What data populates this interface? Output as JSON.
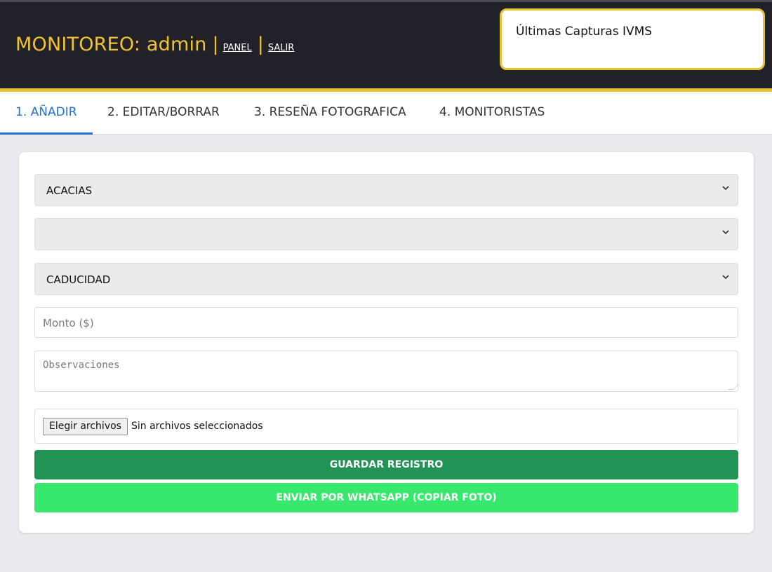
{
  "header": {
    "title": "MONITOREO: admin",
    "separator": "|",
    "links": [
      "PANEL",
      "SALIR"
    ]
  },
  "captures_panel": {
    "title": "Últimas Capturas IVMS"
  },
  "tabs": [
    {
      "label": "1. AÑADIR",
      "active": true
    },
    {
      "label": "2. EDITAR/BORRAR",
      "active": false
    },
    {
      "label": "3. RESEÑA FOTOGRAFICA",
      "active": false
    },
    {
      "label": "4. MONITORISTAS",
      "active": false
    }
  ],
  "form": {
    "location_select": {
      "value": "ACACIAS"
    },
    "second_select": {
      "value": ""
    },
    "type_select": {
      "value": "CADUCIDAD"
    },
    "amount_input": {
      "placeholder": "Monto ($)"
    },
    "notes_textarea": {
      "placeholder": "Observaciones"
    },
    "file_input": {
      "button_label": "Elegir archivos",
      "status": "Sin archivos seleccionados"
    },
    "save_button": {
      "label": "GUARDAR REGISTRO"
    },
    "whatsapp_button": {
      "label": "ENVIAR POR WHATSAPP (COPIAR FOTO)"
    }
  },
  "colors": {
    "header_bg": "#212229",
    "accent_yellow": "#e8c22c",
    "tab_active": "#1f6fd6",
    "save_green": "#219355",
    "whatsapp_green": "#36e86c"
  },
  "icons": {
    "select_arrow": "chevron-down-icon"
  }
}
